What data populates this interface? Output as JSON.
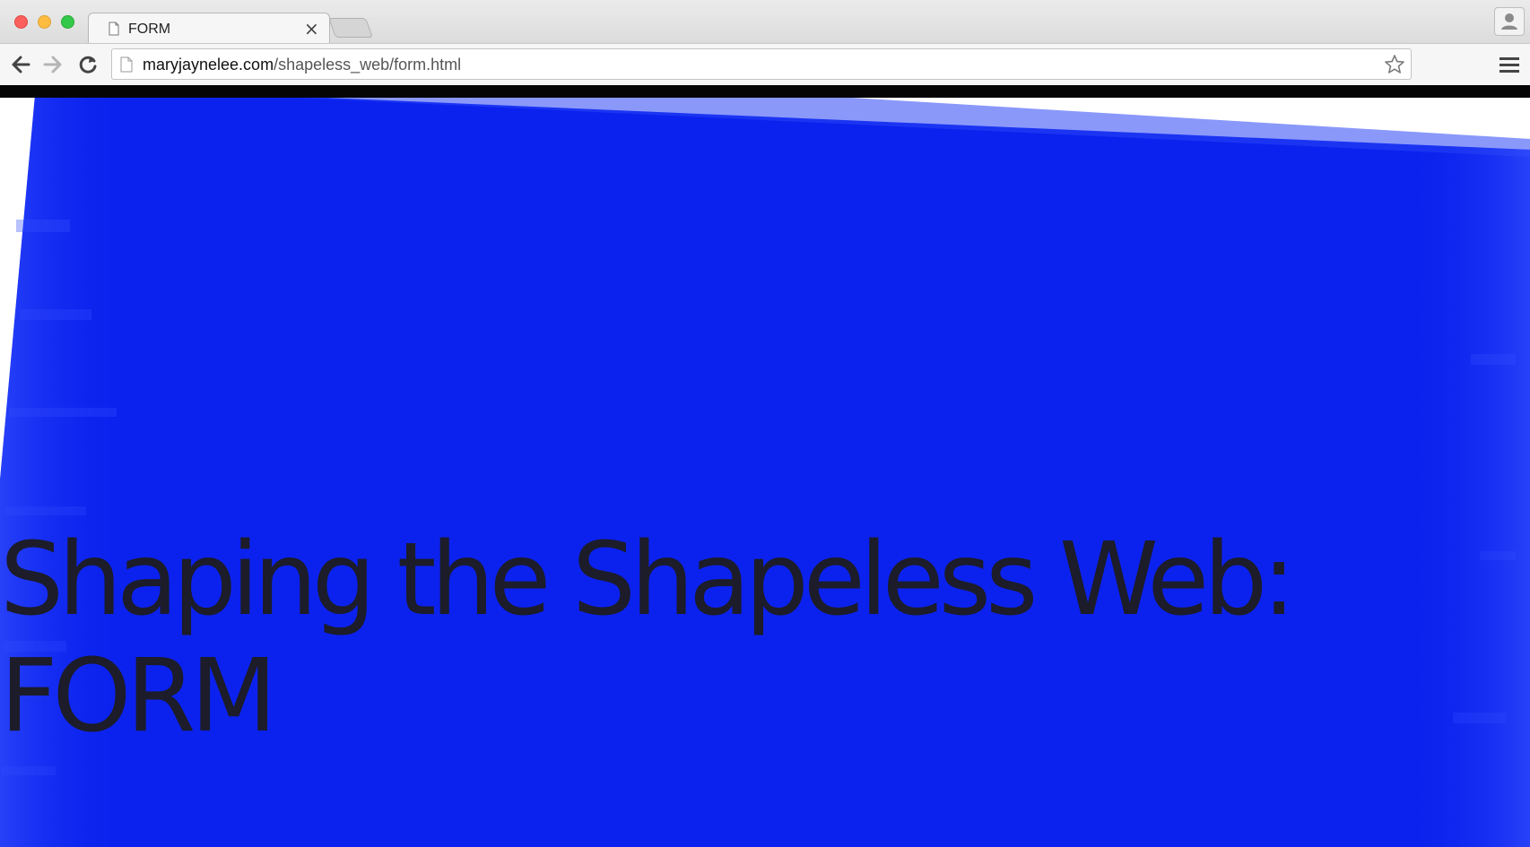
{
  "window": {
    "tab_title": "FORM",
    "tab_close_glyph": "×",
    "icons": [
      "close-window-icon",
      "minimize-window-icon",
      "maximize-window-icon",
      "document-icon",
      "new-tab-icon",
      "profile-icon"
    ]
  },
  "toolbar": {
    "url_host": "maryjaynelee.com",
    "url_path": "/shapeless_web/form.html",
    "icons": [
      "back-arrow-icon",
      "forward-arrow-icon",
      "reload-icon",
      "page-icon",
      "bookmark-star-icon",
      "menu-icon"
    ]
  },
  "page": {
    "heading_line1": "Shaping the Shapeless Web:",
    "heading_line2": "FORM"
  },
  "colors": {
    "panel_blue": "#0b22ee",
    "heading_text": "#1c1c2a",
    "top_bar": "#050505"
  }
}
